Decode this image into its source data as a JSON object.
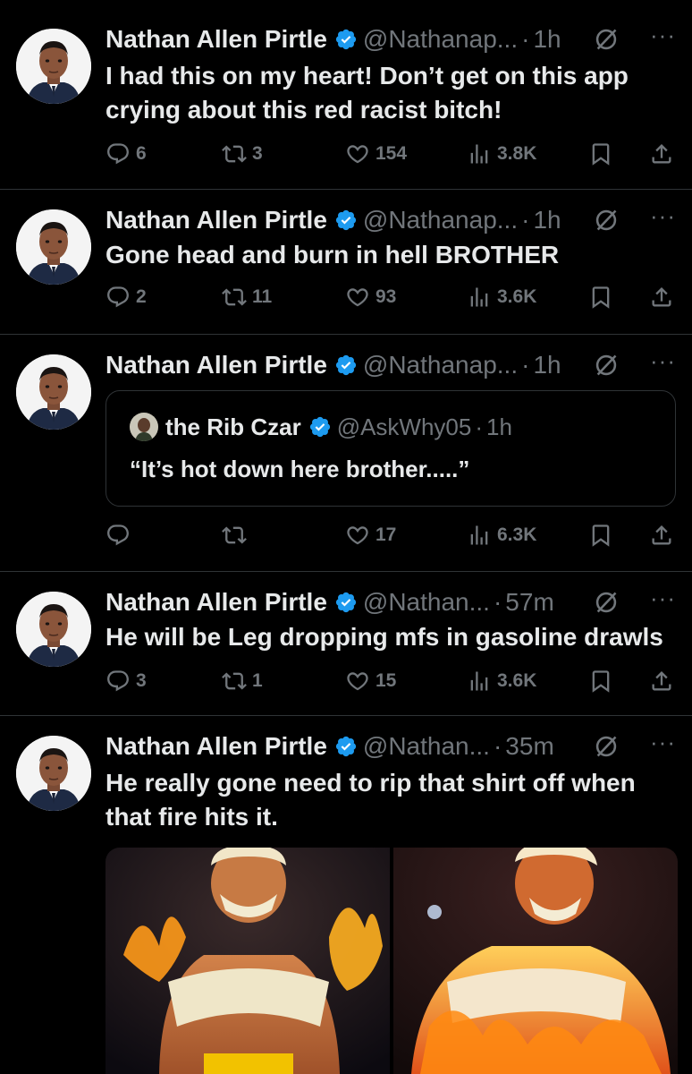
{
  "colors": {
    "accent": "#1d9bf0",
    "muted": "#71767b",
    "text": "#e7e9ea",
    "divider": "#2f3336",
    "background": "#000000"
  },
  "tweets": [
    {
      "name": "Nathan Allen Pirtle",
      "handle": "@Nathanap...",
      "dot": "·",
      "time": "1h",
      "text": "I had this on my heart! Don’t get on this app crying about this red racist bitch!",
      "replies": "6",
      "reposts": "3",
      "likes": "154",
      "views": "3.8K"
    },
    {
      "name": "Nathan Allen Pirtle",
      "handle": "@Nathanap...",
      "dot": "·",
      "time": "1h",
      "text": "Gone head and burn in hell BROTHER",
      "replies": "2",
      "reposts": "11",
      "likes": "93",
      "views": "3.6K"
    },
    {
      "name": "Nathan Allen Pirtle",
      "handle": "@Nathanap...",
      "dot": "·",
      "time": "1h",
      "quote": {
        "name": "the Rib Czar",
        "handle": "@AskWhy05",
        "dot": "·",
        "time": "1h",
        "text": "“It’s hot down here brother.....”"
      },
      "replies": "",
      "reposts": "",
      "likes": "17",
      "views": "6.3K"
    },
    {
      "name": "Nathan Allen Pirtle",
      "handle": "@Nathan...",
      "dot": "·",
      "time": "57m",
      "text": "He will be Leg dropping mfs in gasoline drawls",
      "replies": "3",
      "reposts": "1",
      "likes": "15",
      "views": "3.6K"
    },
    {
      "name": "Nathan Allen Pirtle",
      "handle": "@Nathan...",
      "dot": "·",
      "time": "35m",
      "text": "He really gone need to rip that shirt off when that fire hits it."
    }
  ],
  "icons": {
    "reply": "reply-icon",
    "repost": "repost-icon",
    "like": "heart-icon",
    "views": "views-icon",
    "bookmark": "bookmark-icon",
    "share": "share-icon",
    "verified": "verified-badge-icon",
    "grok": "grok-icon",
    "more": "more-icon"
  },
  "more_glyph": "···"
}
